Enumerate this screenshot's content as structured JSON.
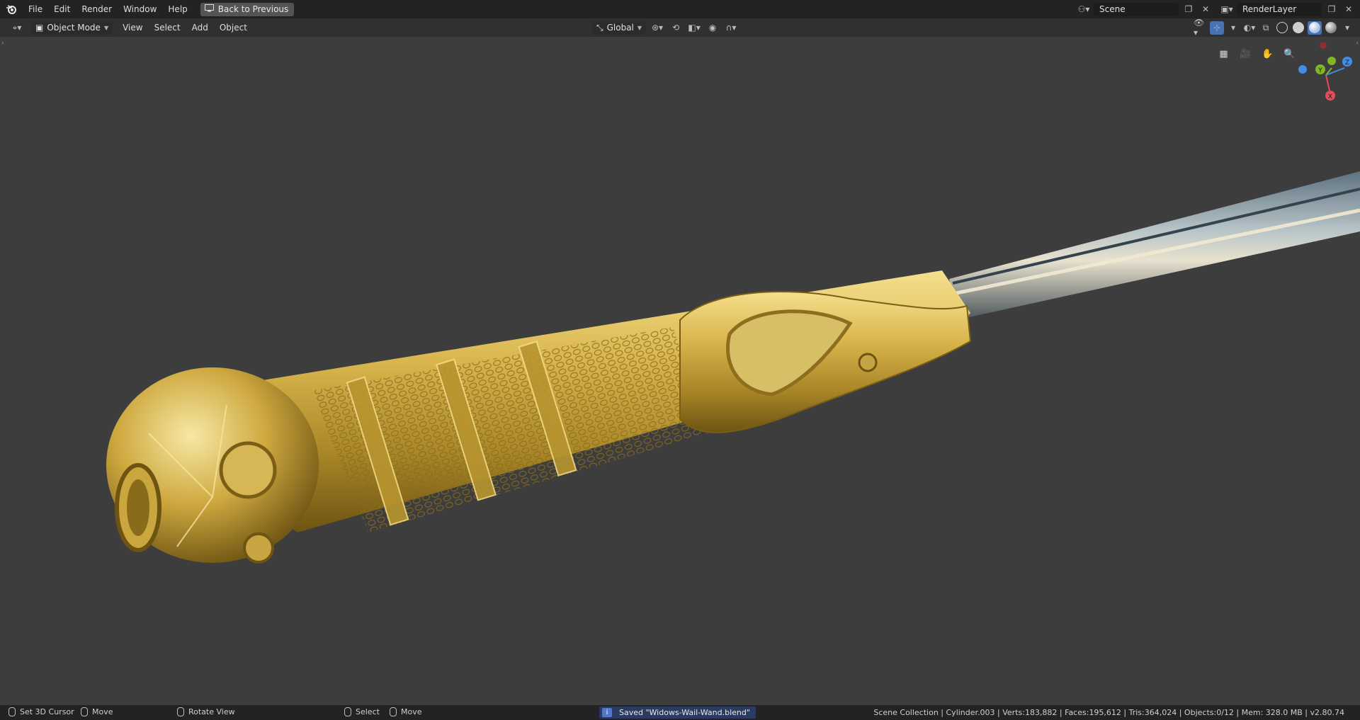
{
  "topbar": {
    "menu": [
      "File",
      "Edit",
      "Render",
      "Window",
      "Help"
    ],
    "back_button": "Back to Previous",
    "scene": "Scene",
    "render_layer": "RenderLayer"
  },
  "header": {
    "mode": "Object Mode",
    "menus": [
      "View",
      "Select",
      "Add",
      "Object"
    ],
    "transform_orientation": "Global"
  },
  "gizmo": {
    "x": "X",
    "y": "Y",
    "z": "Z",
    "colors": {
      "x": "#e44c5a",
      "y": "#7fb824",
      "z": "#3f8ee8"
    }
  },
  "statusbar": {
    "left": [
      "Set 3D Cursor",
      "Move",
      "Rotate View",
      "Select",
      "Move"
    ],
    "message": "Saved \"Widows-Wail-Wand.blend\"",
    "stats": "Scene Collection | Cylinder.003 | Verts:183,882 | Faces:195,612 | Tris:364,024 | Objects:0/12 | Mem: 328.0 MB | v2.80.74"
  },
  "icons": [
    "blender-logo",
    "editor-type",
    "object-mode",
    "pivot",
    "snap",
    "proportional",
    "overlay",
    "shading",
    "grid",
    "camera",
    "hand",
    "zoom"
  ]
}
